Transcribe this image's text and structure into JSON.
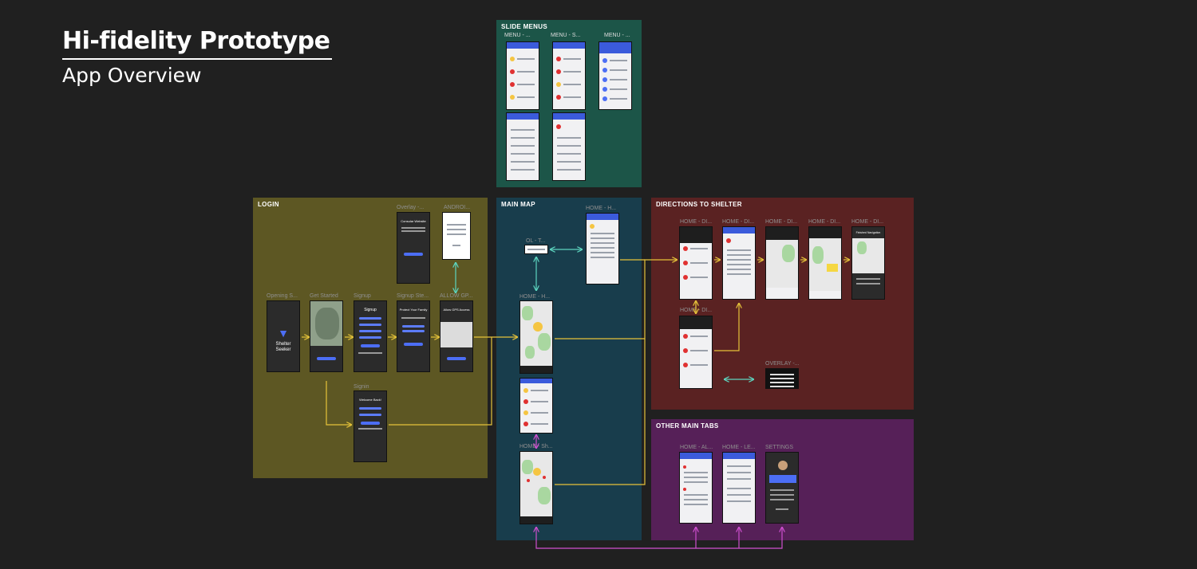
{
  "header": {
    "title": "Hi-fidelity Prototype",
    "subtitle": "App Overview"
  },
  "sections": {
    "slide_menus": {
      "label": "SLIDE MENUS",
      "frames": [
        "MENU - ...",
        "MENU - S...",
        "MENU - ..."
      ]
    },
    "login": {
      "label": "LOGIN",
      "frames": [
        "Opening S...",
        "Get Started",
        "Signup",
        "Signup Ste...",
        "ALLOW GP...",
        "Overlay -...",
        "ANDROI...",
        "Signin"
      ]
    },
    "main_map": {
      "label": "MAIN MAP",
      "frames": [
        "OL - T...",
        "HOME - H...",
        "HOME - H...",
        "HOME - Sh..."
      ]
    },
    "directions": {
      "label": "DIRECTIONS TO SHELTER",
      "frames": [
        "HOME - DI...",
        "HOME - DI...",
        "HOME - DI...",
        "HOME - DI...",
        "HOME - DI...",
        "HOME - DI...",
        "OVERLAY -..."
      ]
    },
    "other_tabs": {
      "label": "OTHER MAIN TABS",
      "frames": [
        "HOME - AL...",
        "HOME - LE...",
        "SETTINGS"
      ]
    }
  },
  "screen_text": {
    "shelter": "Shelter",
    "seeker": "Seeker",
    "signup": "Signup",
    "welcome": "Welcome Back!",
    "protect": "Protect Your Family",
    "allow_gps": "Allow GPS Access",
    "consular": "Consular Website",
    "finished": "Finished Navigation"
  },
  "colors": {
    "login": "#5d5723",
    "main_map": "#183d4c",
    "slide_menus": "#1c5548",
    "directions": "#5a2222",
    "other_tabs": "#562058",
    "arrow_yellow": "#e6c33a",
    "arrow_teal": "#5dd6c0",
    "arrow_magenta": "#cf4fcf"
  }
}
